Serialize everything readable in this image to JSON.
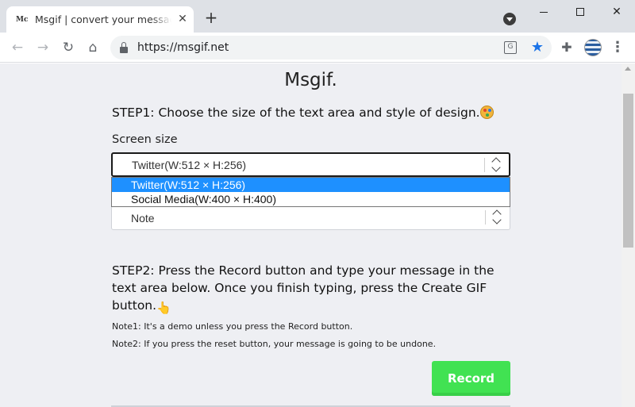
{
  "browser": {
    "tab_favicon": "Mc",
    "tab_title": "Msgif | convert your message into GIF",
    "tab_close": "✕",
    "new_tab": "+",
    "url": "https://msgif.net",
    "translate_glyph": "G",
    "star_glyph": "★",
    "extensions_glyph": "✚",
    "menu_glyph": "⋮",
    "window_close": "✕"
  },
  "page": {
    "logo_main": "Msgif",
    "logo_dot": ".",
    "step1": "STEP1: Choose the size of the text area and style of design.",
    "screen_size_label": "Screen size",
    "screen_size_value": "Twitter(W:512 × H:256)",
    "screen_size_options": [
      "Twitter(W:512 × H:256)",
      "Social Media(W:400 × H:400)"
    ],
    "style_value": "Note",
    "step2": "STEP2: Press the Record button and type your message in the text area below. Once you finish typing, press the Create GIF button.",
    "hand_glyph": "👆",
    "note1": "Note1: It's a demo unless you press the Record button.",
    "note2": "Note2: If you press the reset button, your message is going to be undone.",
    "record_label": "Record"
  },
  "colors": {
    "record_button": "#41e252",
    "selected_option": "#1e90ff",
    "page_background": "#eeeff3"
  }
}
